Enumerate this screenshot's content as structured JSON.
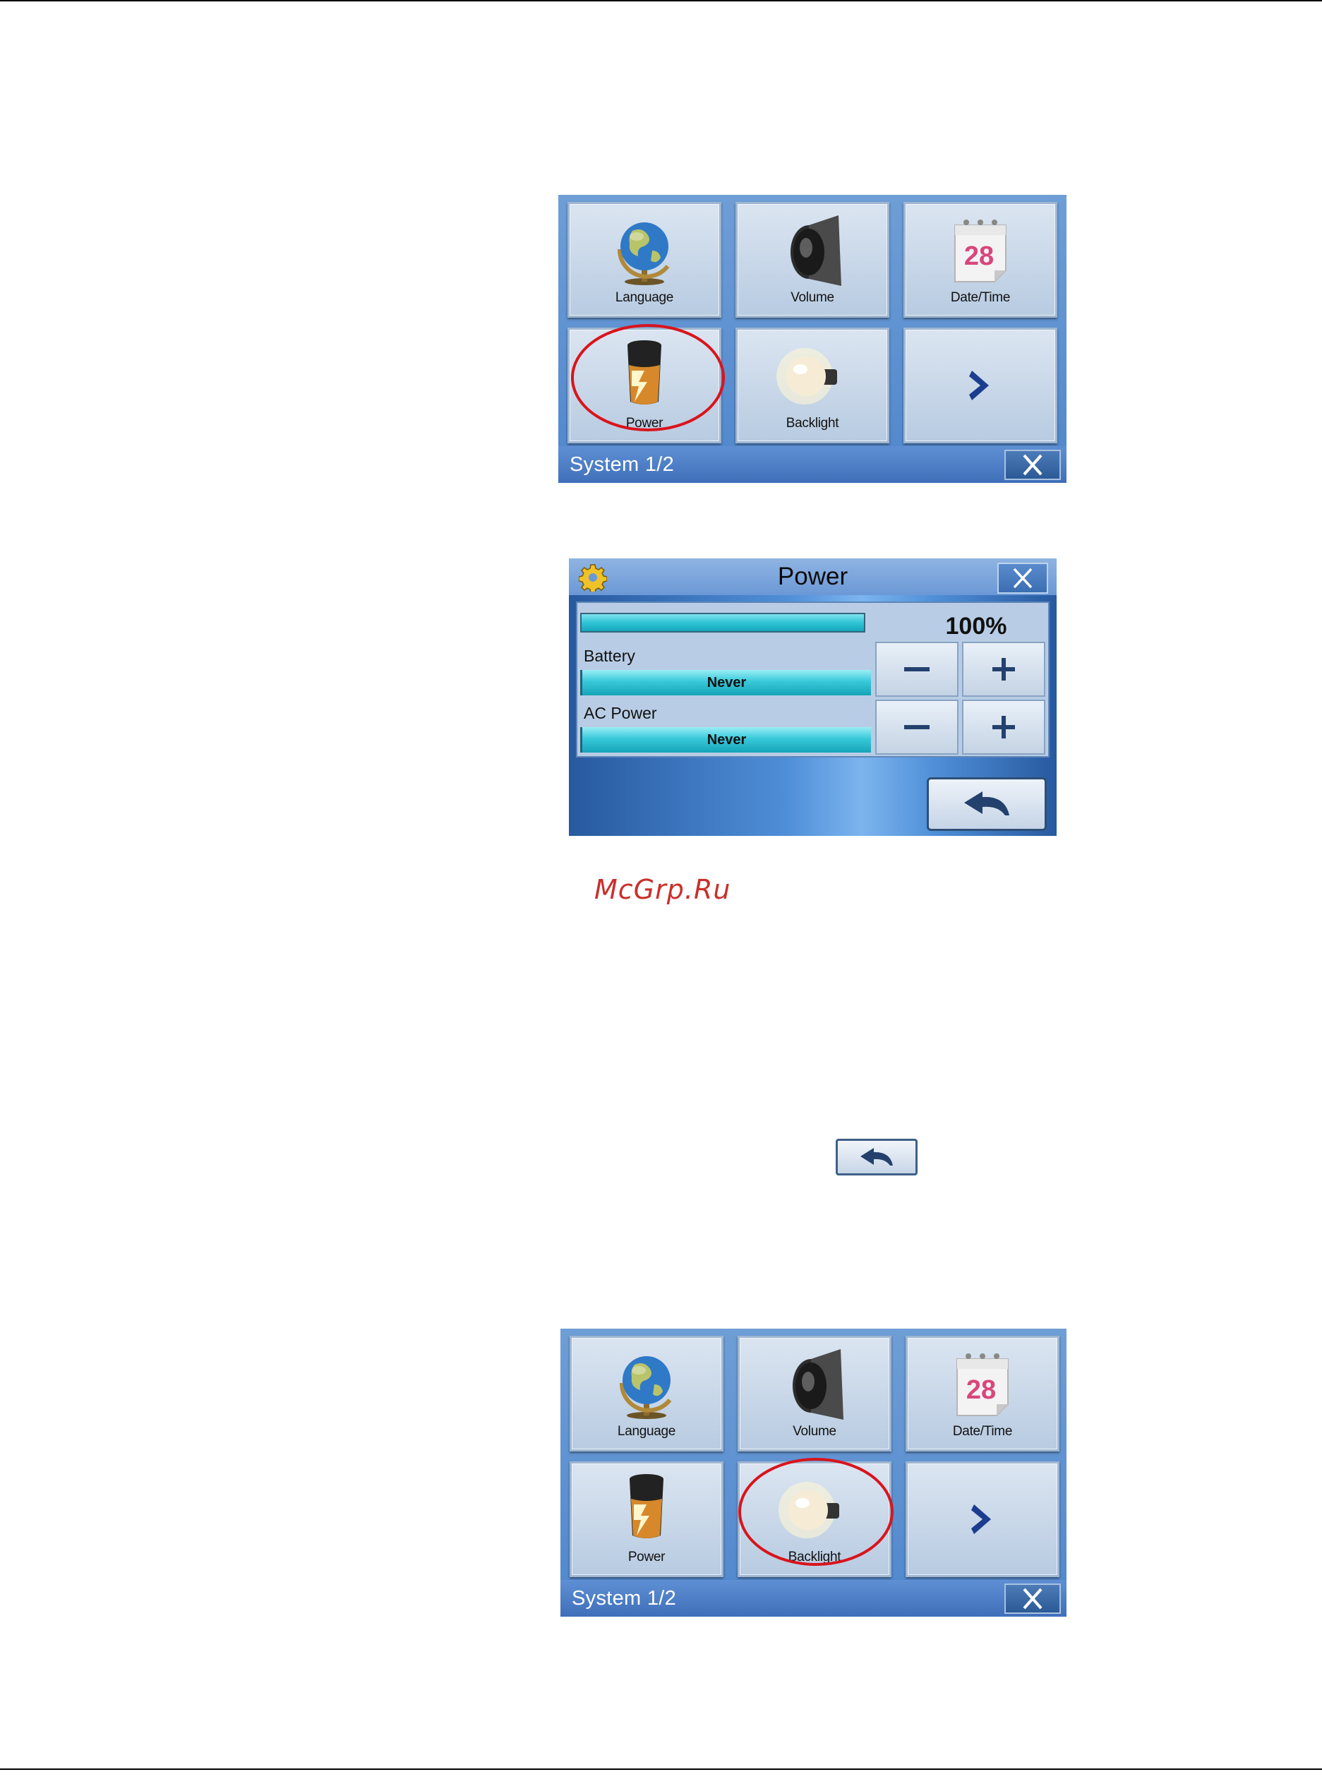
{
  "system_menu_1": {
    "footer_title": "System 1/2",
    "tiles": [
      {
        "label": "Language",
        "icon": "globe-icon"
      },
      {
        "label": "Volume",
        "icon": "speaker-icon"
      },
      {
        "label": "Date/Time",
        "icon": "calendar-icon",
        "calendar_day": "28"
      },
      {
        "label": "Power",
        "icon": "battery-icon"
      },
      {
        "label": "Backlight",
        "icon": "bulb-icon"
      },
      {
        "label": "",
        "icon": "chevron-right-icon"
      }
    ],
    "highlighted_tile": "Power"
  },
  "power_dialog": {
    "title": "Power",
    "level_percent": "100%",
    "battery_label": "Battery",
    "battery_value": "Never",
    "ac_label": "AC Power",
    "ac_value": "Never"
  },
  "watermark": "McGrp.Ru",
  "system_menu_2": {
    "footer_title": "System 1/2",
    "tiles": [
      {
        "label": "Language",
        "icon": "globe-icon"
      },
      {
        "label": "Volume",
        "icon": "speaker-icon"
      },
      {
        "label": "Date/Time",
        "icon": "calendar-icon",
        "calendar_day": "28"
      },
      {
        "label": "Power",
        "icon": "battery-icon"
      },
      {
        "label": "Backlight",
        "icon": "bulb-icon"
      },
      {
        "label": "",
        "icon": "chevron-right-icon"
      }
    ],
    "highlighted_tile": "Backlight"
  },
  "colors": {
    "highlight": "#d9141c",
    "panel_blue": "#4f86cc",
    "level_bar": "#2fc4d6"
  }
}
